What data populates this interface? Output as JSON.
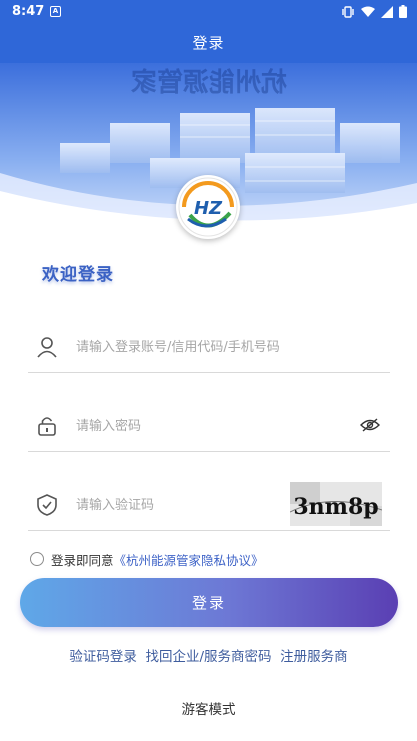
{
  "status_bar": {
    "time": "8:47",
    "notification_badge": "A"
  },
  "title_bar": {
    "title": "登录"
  },
  "banner": {
    "skyline_text": "杭州能源管家"
  },
  "logo": {
    "text": "HZ"
  },
  "welcome": "欢迎登录",
  "fields": {
    "account": {
      "placeholder": "请输入登录账号/信用代码/手机号码"
    },
    "password": {
      "placeholder": "请输入密码"
    },
    "captcha": {
      "placeholder": "请输入验证码",
      "image_text": "3nm8p"
    }
  },
  "agreement": {
    "prefix": "登录即同意",
    "link": "《杭州能源管家隐私协议》"
  },
  "login_button": "登录",
  "links": {
    "sms_login": "验证码登录",
    "recover": "找回企业/服务商密码",
    "register": "注册服务商"
  },
  "guest_mode": "游客模式",
  "colors": {
    "primary": "#2f67d8",
    "link": "#3e63c7",
    "gradient_start": "#5fa8e8",
    "gradient_end": "#5a3fb3"
  }
}
